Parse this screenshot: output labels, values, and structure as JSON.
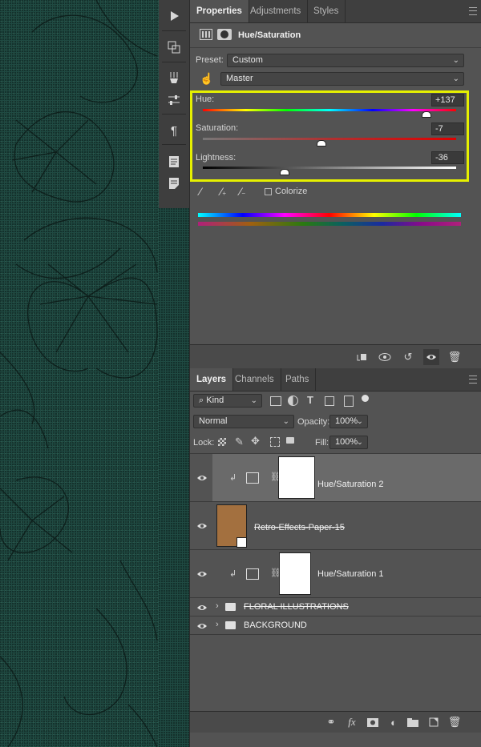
{
  "toolbar": {
    "tools": [
      "play-icon",
      "brush-clone-source-icon",
      "brush-settings-icon",
      "sliders-icon",
      "paragraph-icon",
      "character-styles-icon",
      "paragraph-styles-icon"
    ]
  },
  "properties": {
    "tabs": [
      "Properties",
      "Adjustments",
      "Styles"
    ],
    "title": "Hue/Saturation",
    "preset_label": "Preset:",
    "preset_value": "Custom",
    "channel_value": "Master",
    "hue_label": "Hue:",
    "hue_value": "+137",
    "saturation_label": "Saturation:",
    "saturation_value": "-7",
    "lightness_label": "Lightness:",
    "lightness_value": "-36",
    "hue_level": 137,
    "saturation_level": -7,
    "lightness_level": -36,
    "colorize_label": "Colorize",
    "highlight_color": "#e6f000"
  },
  "layers": {
    "tabs": [
      "Layers",
      "Channels",
      "Paths"
    ],
    "filter_kind": "Kind",
    "blend_mode": "Normal",
    "opacity_label": "Opacity:",
    "opacity_value": "100%",
    "lock_label": "Lock:",
    "fill_label": "Fill:",
    "fill_value": "100%",
    "items": [
      {
        "name": "Hue/Saturation 2"
      },
      {
        "name": "Retro-Effects-Paper-15"
      },
      {
        "name": "Hue/Saturation 1"
      },
      {
        "name": "FLORAL ILLUSTRATIONS"
      },
      {
        "name": "BACKGROUND"
      }
    ]
  }
}
